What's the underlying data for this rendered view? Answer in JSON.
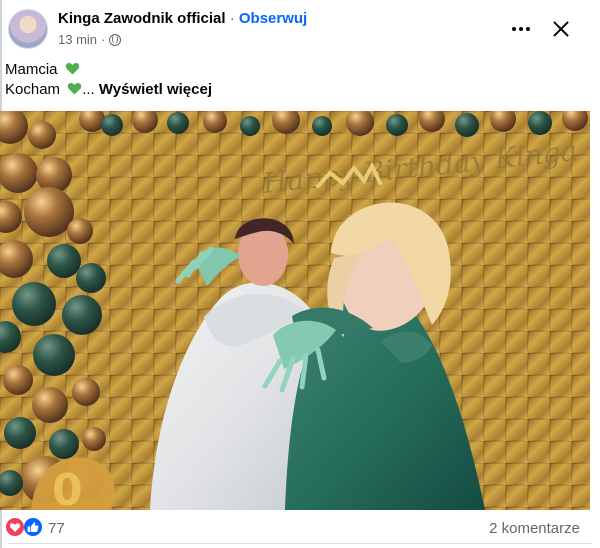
{
  "post": {
    "author": "Kinga Zawodnik official",
    "separator": "·",
    "follow_label": "Obserwuj",
    "time": "13 min",
    "audience_icon": "globe-icon",
    "more_icon": "more-options-icon",
    "close_icon": "close-icon",
    "text_line1": "Mamcia",
    "text_line2": "Kocham",
    "ellipsis": "...",
    "see_more": "Wyświetl więcej",
    "heart_color": "#3da83d"
  },
  "photo": {
    "banner_text": "Happy Birthday Kinga",
    "balloon_number": "0"
  },
  "engagement": {
    "reaction_icons": [
      "love-reaction-icon",
      "like-reaction-icon"
    ],
    "reaction_count": "77",
    "comments_label": "2 komentarze"
  },
  "colors": {
    "link_blue": "#0866ff",
    "secondary_text": "#65676b",
    "gold_background": "#b88d2b",
    "green_dress": "#1e6b55"
  }
}
